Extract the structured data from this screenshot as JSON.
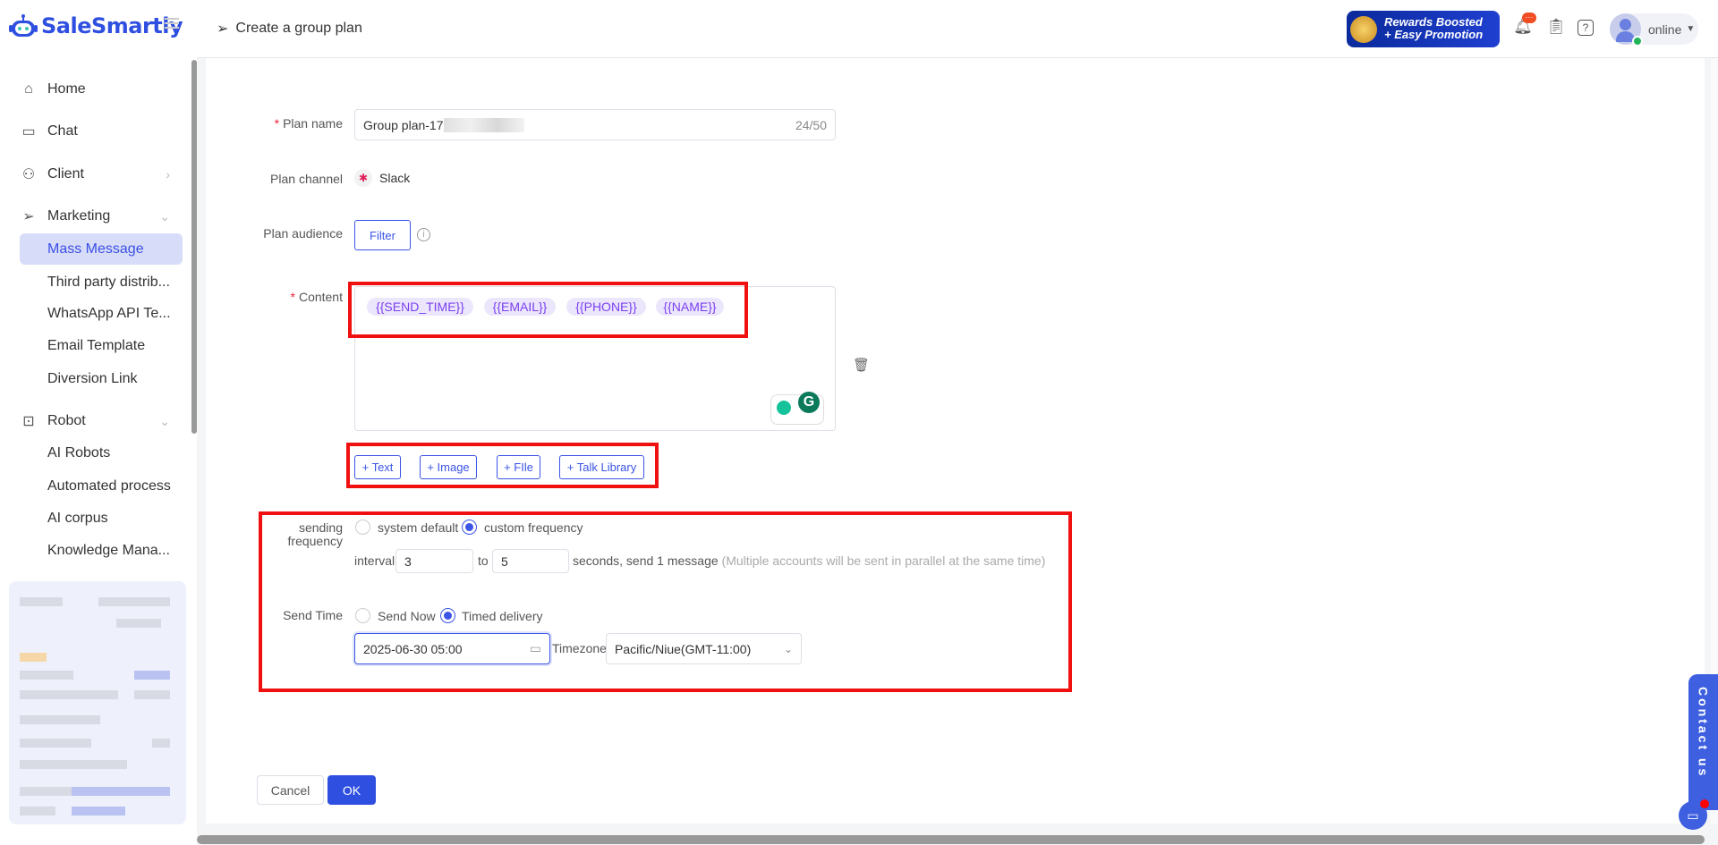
{
  "app": {
    "logo": "SaleSmartly"
  },
  "header": {
    "title": "Create a group plan",
    "banner_line1": "Rewards Boosted",
    "banner_line2": "+ Easy Promotion",
    "notif_badge": "···",
    "status": "online"
  },
  "sidebar": {
    "items": [
      {
        "label": "Home",
        "icon": "home-icon"
      },
      {
        "label": "Chat",
        "icon": "chat-icon"
      },
      {
        "label": "Client",
        "icon": "client-icon"
      },
      {
        "label": "Marketing",
        "icon": "send-icon"
      },
      {
        "label": "Mass Message"
      },
      {
        "label": "Third party distrib..."
      },
      {
        "label": "WhatsApp API Te..."
      },
      {
        "label": "Email Template"
      },
      {
        "label": "Diversion Link"
      },
      {
        "label": "Robot",
        "icon": "robot-icon"
      },
      {
        "label": "AI Robots"
      },
      {
        "label": "Automated process"
      },
      {
        "label": "AI corpus"
      },
      {
        "label": "Knowledge Mana..."
      }
    ]
  },
  "form": {
    "plan_name_label": "Plan name",
    "plan_name_value": "Group plan-17",
    "plan_name_count": "24/50",
    "plan_channel_label": "Plan channel",
    "plan_channel_value": "Slack",
    "plan_audience_label": "Plan audience",
    "filter_label": "Filter",
    "content_label": "Content",
    "tags": [
      "{{SEND_TIME}}",
      "{{EMAIL}}",
      "{{PHONE}}",
      "{{NAME}}"
    ],
    "add_buttons": [
      "+ Text",
      "+ Image",
      "+ FIle",
      "+ Talk Library"
    ],
    "freq_label_1": "sending",
    "freq_label_2": "frequency",
    "freq_options": [
      "system default",
      "custom frequency"
    ],
    "interval_label": "interval",
    "interval_from": "3",
    "to_label": "to",
    "interval_to": "5",
    "interval_suffix": "seconds, send 1 message",
    "interval_note": "(Multiple accounts will be sent in parallel at the same time)",
    "send_time_label": "Send Time",
    "send_options": [
      "Send Now",
      "Timed delivery"
    ],
    "date_value": "2025-06-30 05:00",
    "timezone_label": "Timezone",
    "timezone_value": "Pacific/Niue(GMT-11:00)",
    "cancel_label": "Cancel",
    "ok_label": "OK"
  },
  "contact": {
    "label": "Contact us"
  },
  "colors": {
    "accent": "#3b55e6",
    "highlight": "#f01010"
  }
}
